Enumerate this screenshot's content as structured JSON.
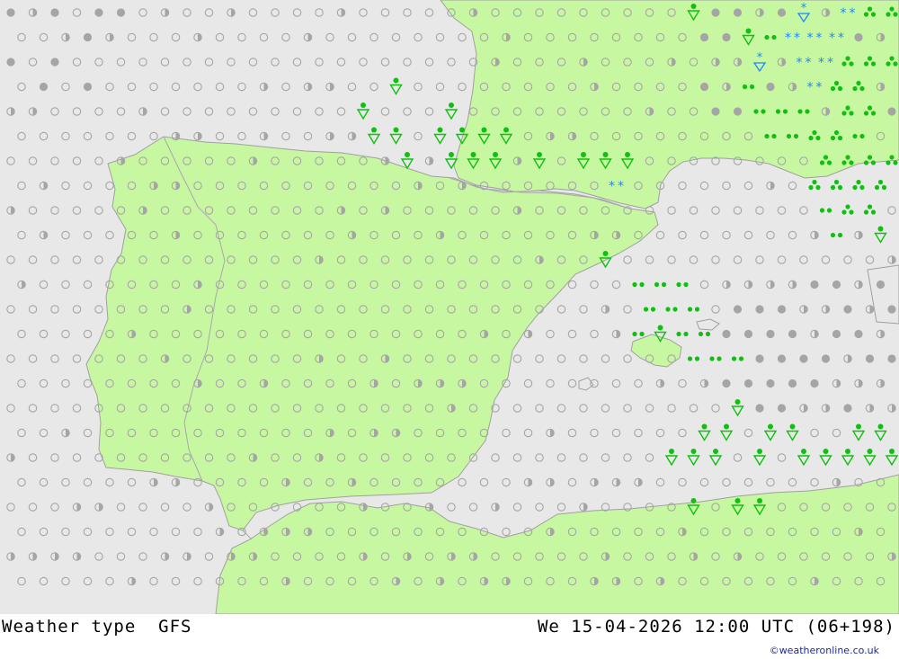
{
  "map": {
    "colors": {
      "sea": "#e8e8e8",
      "land": "#c8f7a2",
      "border": "#a0a0a0",
      "coast": "#a0a0a0",
      "symbol_gray": "#a5a5a5",
      "rain_green": "#10c010",
      "snow_blue": "#1a88ff"
    },
    "legend_symbols": [
      "empty-circle: clear",
      "half-circle: partly cloudy",
      "filled-circle: cloudy",
      "double-dot: light rain",
      "triangle-dot: showers",
      "asterisk: snow"
    ]
  },
  "footer": {
    "title": "Weather type",
    "model": "GFS",
    "datetime": "We 15-04-2026 12:00 UTC (06+198)",
    "credit": "©weatheronline.co.uk"
  }
}
